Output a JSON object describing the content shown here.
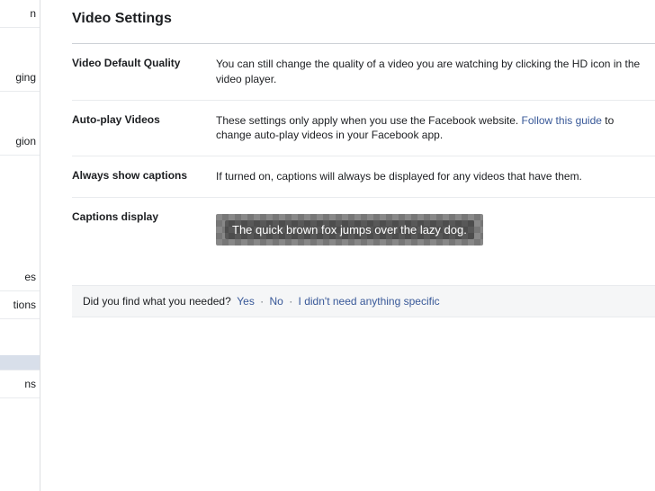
{
  "sidebar": {
    "items": [
      {
        "label": "n"
      },
      {
        "label": "ging"
      },
      {
        "label": "gion"
      },
      {
        "label": "es"
      },
      {
        "label": "tions"
      },
      {
        "label": ""
      },
      {
        "label": "ns"
      }
    ]
  },
  "page": {
    "title": "Video Settings"
  },
  "settings": {
    "quality": {
      "label": "Video Default Quality",
      "desc": "You can still change the quality of a video you are watching by clicking the HD icon in the video player."
    },
    "autoplay": {
      "label": "Auto-play Videos",
      "desc_pre": "These settings only apply when you use the Facebook website. ",
      "link": "Follow this guide",
      "desc_post": " to change auto-play videos in your Facebook app."
    },
    "captions": {
      "label": "Always show captions",
      "desc": "If turned on, captions will always be displayed for any videos that have them."
    },
    "captions_display": {
      "label": "Captions display",
      "preview_text": "The quick brown fox jumps over the lazy dog."
    }
  },
  "feedback": {
    "prompt": "Did you find what you needed?",
    "yes": "Yes",
    "no": "No",
    "none": "I didn't need anything specific",
    "sep": "·"
  }
}
